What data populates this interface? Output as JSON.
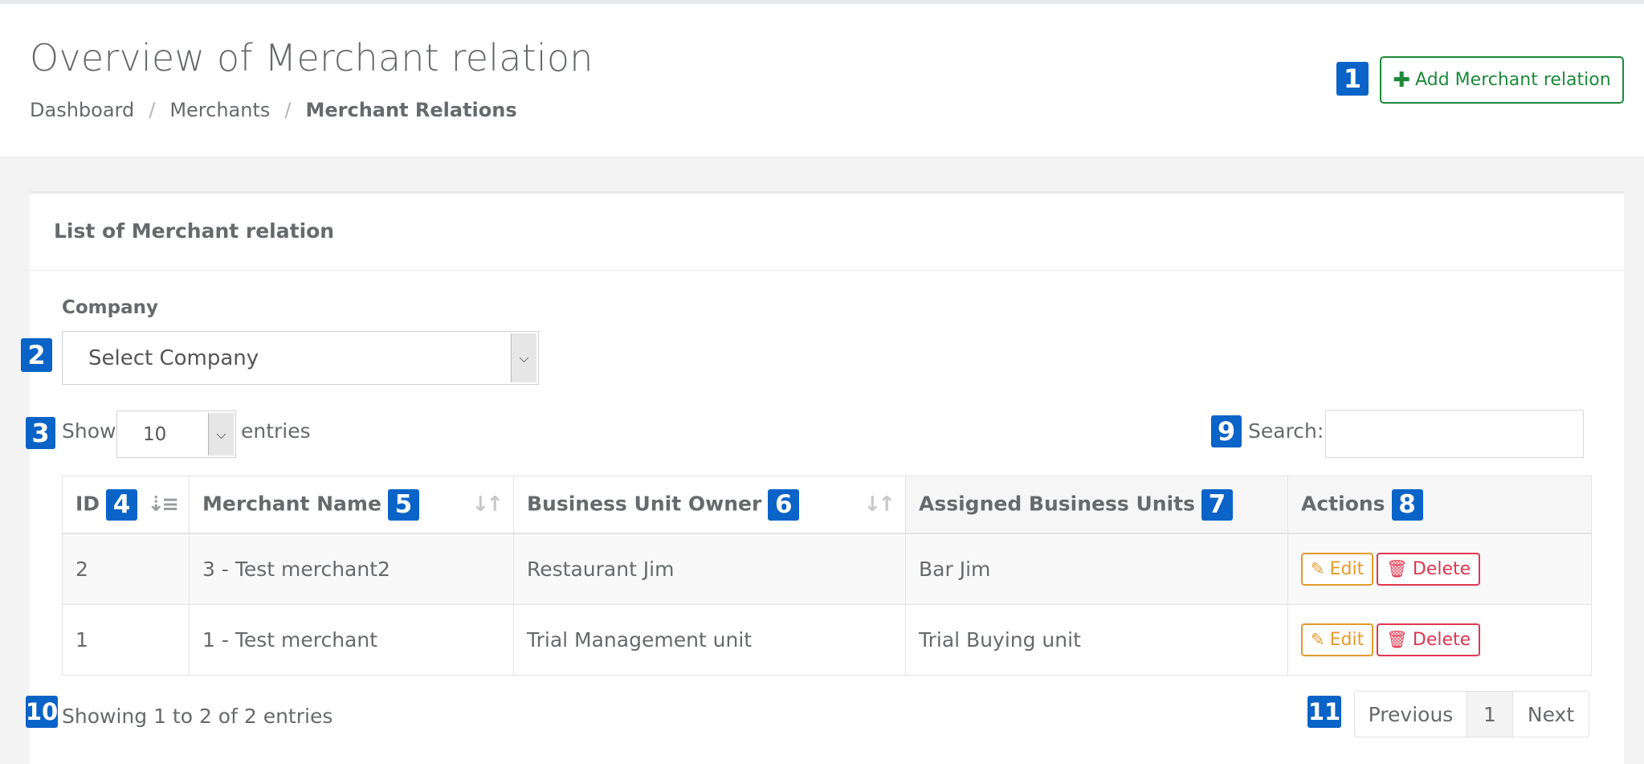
{
  "header": {
    "title": "Overview of Merchant relation",
    "breadcrumb": [
      "Dashboard",
      "Merchants",
      "Merchant Relations"
    ],
    "add_button_label": "Add Merchant relation",
    "add_button_icon": "plus-icon"
  },
  "annotations": [
    "1",
    "2",
    "3",
    "4",
    "5",
    "6",
    "7",
    "8",
    "9",
    "10",
    "11"
  ],
  "panel": {
    "title": "List of Merchant relation",
    "company_label": "Company",
    "company_select_value": "Select Company",
    "show_label": "Show",
    "length_value": "10",
    "entries_label": "entries",
    "search_label": "Search:",
    "search_value": ""
  },
  "table": {
    "columns": [
      "ID",
      "Merchant Name",
      "Business Unit Owner",
      "Assigned Business Units",
      "Actions"
    ],
    "rows": [
      {
        "id": "2",
        "merchant": "3 - Test merchant2",
        "owner": "Restaurant Jim",
        "units": "Bar Jim"
      },
      {
        "id": "1",
        "merchant": "1 - Test merchant",
        "owner": "Trial Management unit",
        "units": "Trial Buying unit"
      }
    ],
    "edit_label": "Edit",
    "delete_label": "Delete"
  },
  "footer": {
    "info": "Showing 1 to 2 of 2 entries",
    "previous_label": "Previous",
    "page": "1",
    "next_label": "Next"
  },
  "colors": {
    "annotation_badge": "#0a63c7",
    "add_button": "#1c8a3a",
    "edit_button": "#e39a2c",
    "delete_button": "#e0374f"
  }
}
